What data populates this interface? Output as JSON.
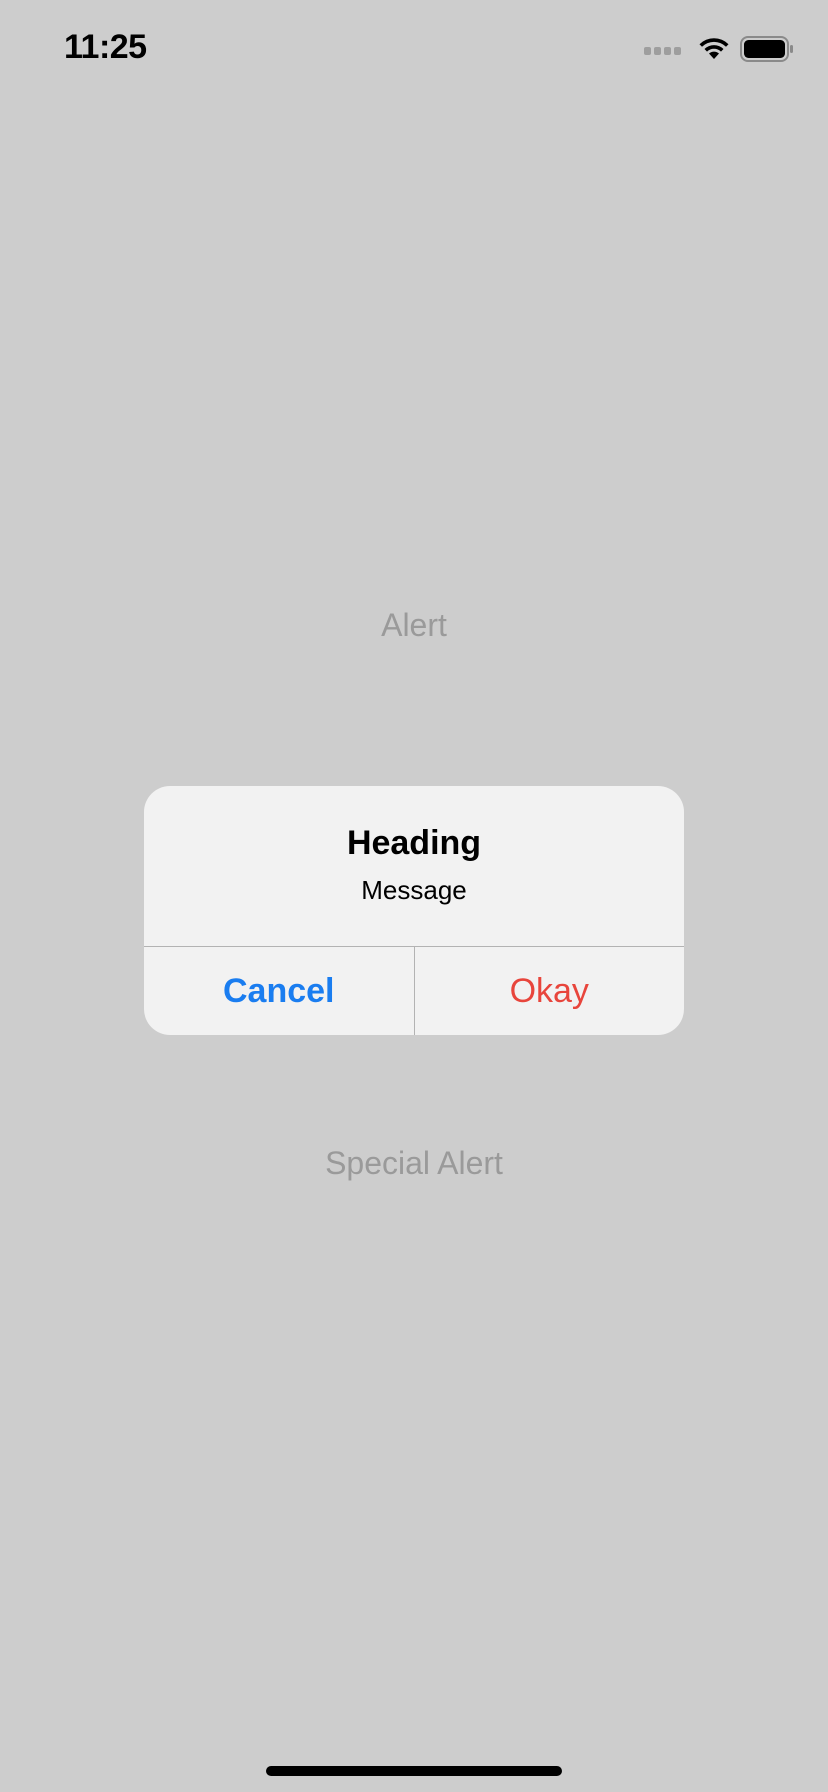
{
  "status_bar": {
    "time": "11:25",
    "icons": [
      "cellular-signal-icon",
      "wifi-icon",
      "battery-icon"
    ]
  },
  "background": {
    "alert_button_label": "Alert",
    "special_alert_button_label": "Special Alert"
  },
  "alert": {
    "title": "Heading",
    "message": "Message",
    "cancel_label": "Cancel",
    "okay_label": "Okay"
  },
  "colors": {
    "background": "#cdcdcd",
    "dialog": "#f2f2f2",
    "cancel": "#1a7df0",
    "okay": "#e8453c",
    "dimmed_text": "#9a9a9a"
  }
}
